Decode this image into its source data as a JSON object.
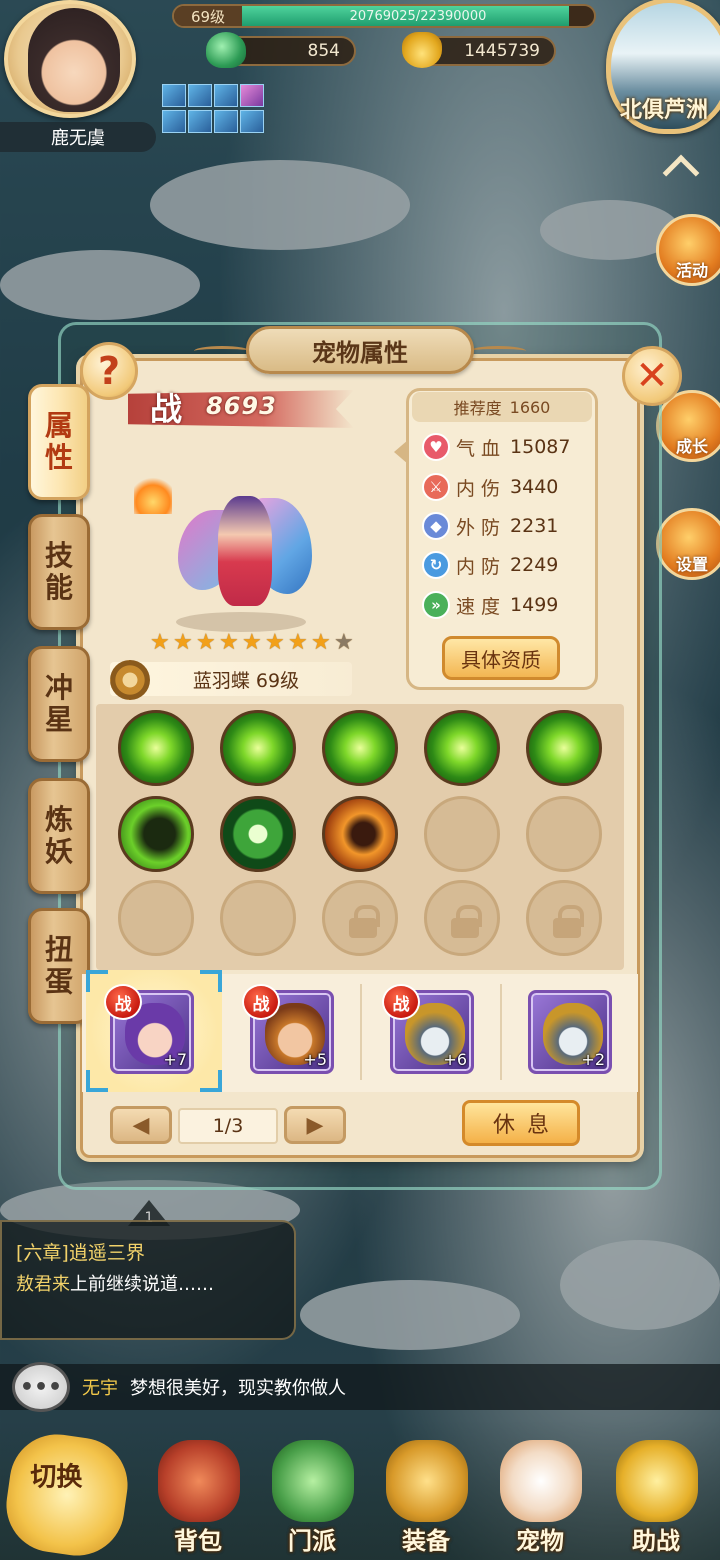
{
  "player": {
    "name": "鹿无虞",
    "level": "69级",
    "exp": "20769025/22390000",
    "exp_fraction": 0.9276,
    "jade": "854",
    "gold": "1445739"
  },
  "map": {
    "name": "北俱芦洲"
  },
  "side_menu": {
    "activity": "活动",
    "grow": "成长",
    "settings": "设置"
  },
  "panel": {
    "title": "宠物属性",
    "help": "?",
    "close": "✕",
    "tabs": [
      {
        "label": "属性",
        "active": true
      },
      {
        "label": "技能",
        "active": false
      },
      {
        "label": "冲星",
        "active": false
      },
      {
        "label": "炼妖",
        "active": false
      },
      {
        "label": "扭蛋",
        "active": false
      }
    ],
    "power_label": "战",
    "power_value": "8693",
    "stars_total": 9,
    "stars_lit": 8,
    "pet_name": "蓝羽蝶 69级",
    "stats": {
      "rec_label": "推荐度",
      "rec_value": "1660",
      "rows": [
        {
          "label": "气 血",
          "value": "15087",
          "icon": "heart-icon",
          "color": "#e85a6a"
        },
        {
          "label": "内 伤",
          "value": "3440",
          "icon": "sword-icon",
          "color": "#e86a5a"
        },
        {
          "label": "外 防",
          "value": "2231",
          "icon": "shield-icon",
          "color": "#6a8ad8"
        },
        {
          "label": "内 防",
          "value": "2249",
          "icon": "swirl-icon",
          "color": "#4a9ae0"
        },
        {
          "label": "速 度",
          "value": "1499",
          "icon": "boot-icon",
          "color": "#4ab05a"
        }
      ],
      "detail_button": "具体资质"
    },
    "pets": [
      {
        "badge": "战",
        "plus": "+7",
        "selected": true
      },
      {
        "badge": "战",
        "plus": "+5",
        "selected": false
      },
      {
        "badge": "战",
        "plus": "+6",
        "selected": false
      },
      {
        "badge": "",
        "plus": "+2",
        "selected": false
      }
    ],
    "pager": {
      "prev": "◀",
      "next": "▶",
      "page": "1/3"
    },
    "rest_button": "休息"
  },
  "quest": {
    "tab": "1",
    "title": "[六章]逍遥三界",
    "speaker": "敖君来",
    "desc": "上前继续说道……"
  },
  "chat": {
    "button": "•••",
    "user": "无宇",
    "message": "梦想很美好，现实教你做人"
  },
  "nav": {
    "switch": "切换",
    "items": [
      "背包",
      "门派",
      "装备",
      "宠物",
      "助战"
    ]
  }
}
